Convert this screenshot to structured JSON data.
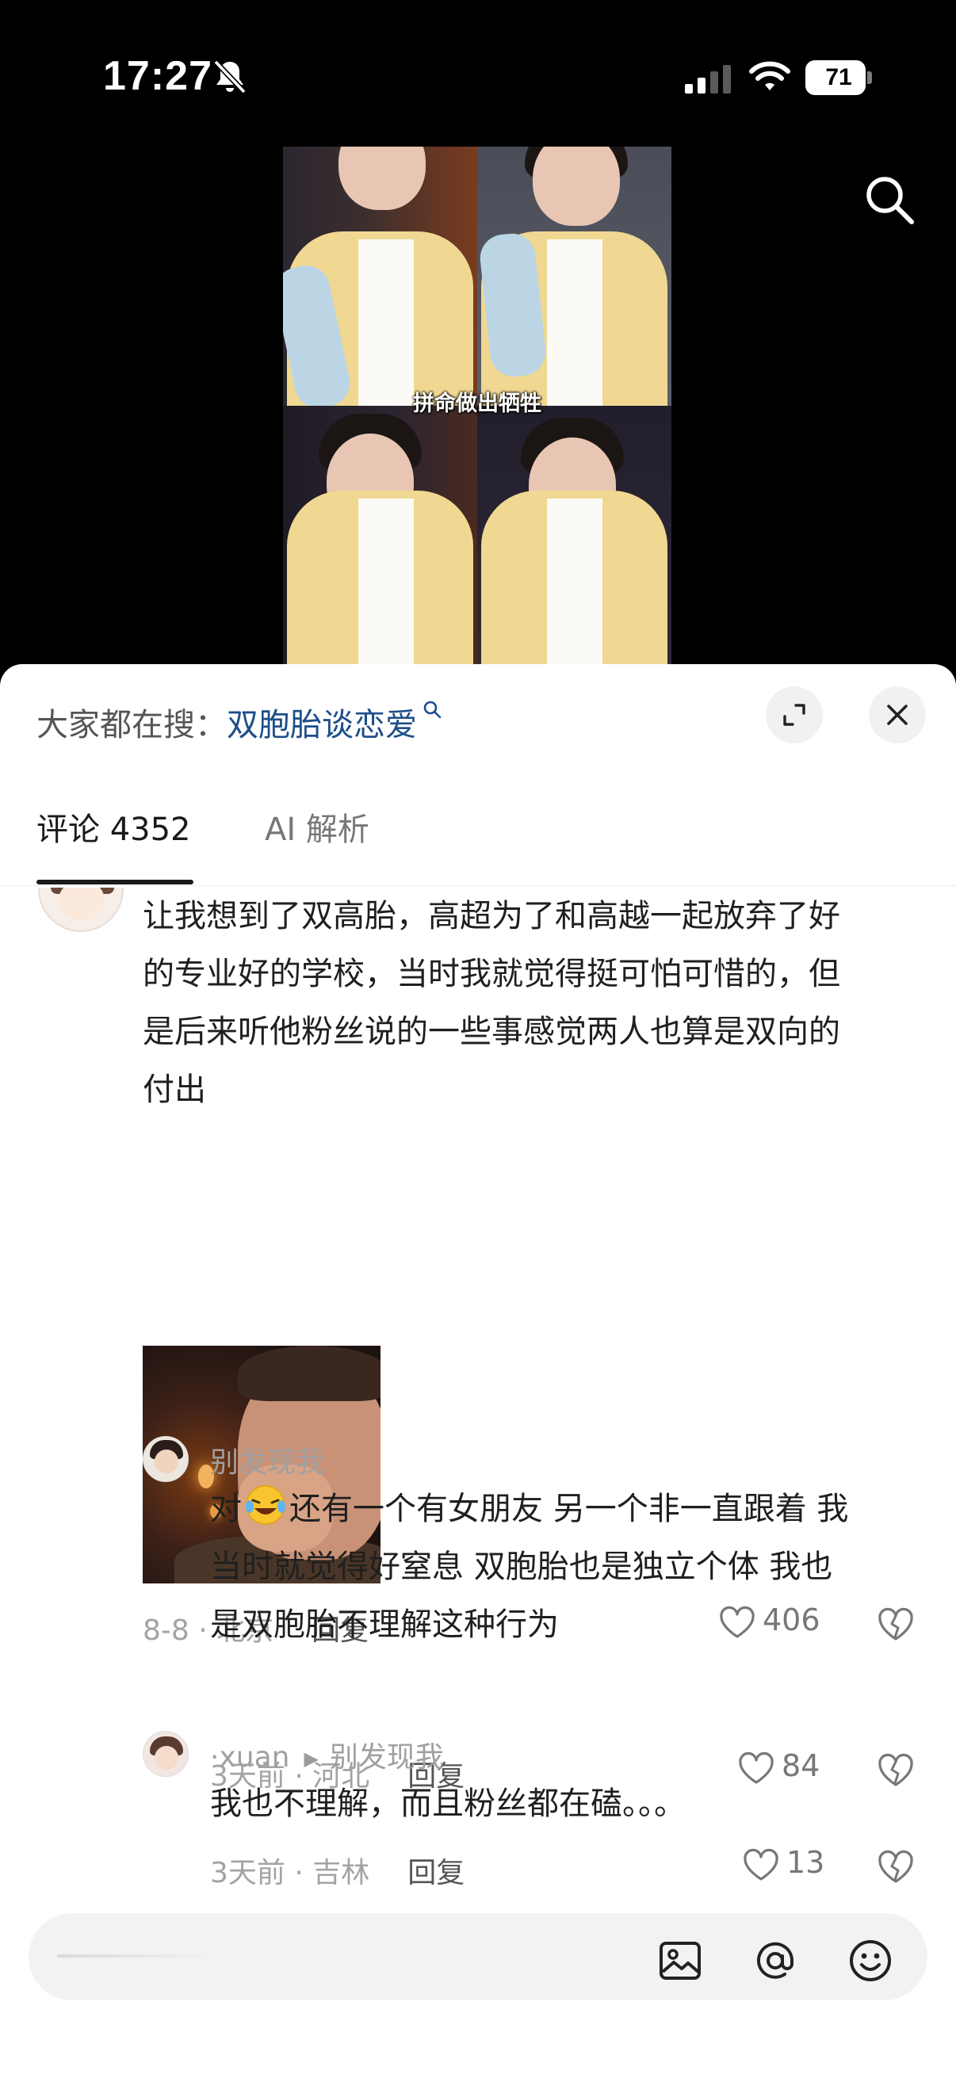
{
  "status_bar": {
    "time": "17:27",
    "battery": "71"
  },
  "video": {
    "caption": "拼命做出牺牲"
  },
  "hot_search": {
    "label": "大家都在搜：",
    "term": "双胞胎谈恋爱"
  },
  "tabs": {
    "comments": "评论 4352",
    "ai": "AI 解析"
  },
  "comments": [
    {
      "lines": [
        "让我想到了双高胎，高超为了和高越一起放弃了好",
        "的专业好的学校，当时我就觉得挺可怕可惜的，但",
        "是后来听他粉丝说的一些事感觉两人也算是双向的",
        "付出"
      ],
      "meta": "8-8 · 北京",
      "reply_label": "回复",
      "likes": "406",
      "replies": [
        {
          "user": "别发现我",
          "text_before_emoji": "对",
          "text_after_emoji": "还有一个有女朋友 另一个非一直跟着 我",
          "lines": [
            "当时就觉得好窒息 双胞胎也是独立个体 我也",
            "是双胞胎不理解这种行为"
          ],
          "meta": "3天前 · 河北",
          "reply_label": "回复",
          "likes": "84"
        },
        {
          "user": "·xuan",
          "reply_to": "别发现我",
          "lines": [
            "我也不理解，而且粉丝都在磕。。。"
          ],
          "meta": "3天前 · 吉林",
          "reply_label": "回复",
          "likes": "13"
        }
      ]
    }
  ],
  "input": {
    "placeholder": ""
  },
  "icons": {
    "accent": "#1d4e89",
    "status": [
      "bell-slash-icon",
      "signal-icon",
      "wifi-icon",
      "battery-icon"
    ],
    "toolbar": [
      "image-icon",
      "at-icon",
      "emoji-icon"
    ]
  }
}
